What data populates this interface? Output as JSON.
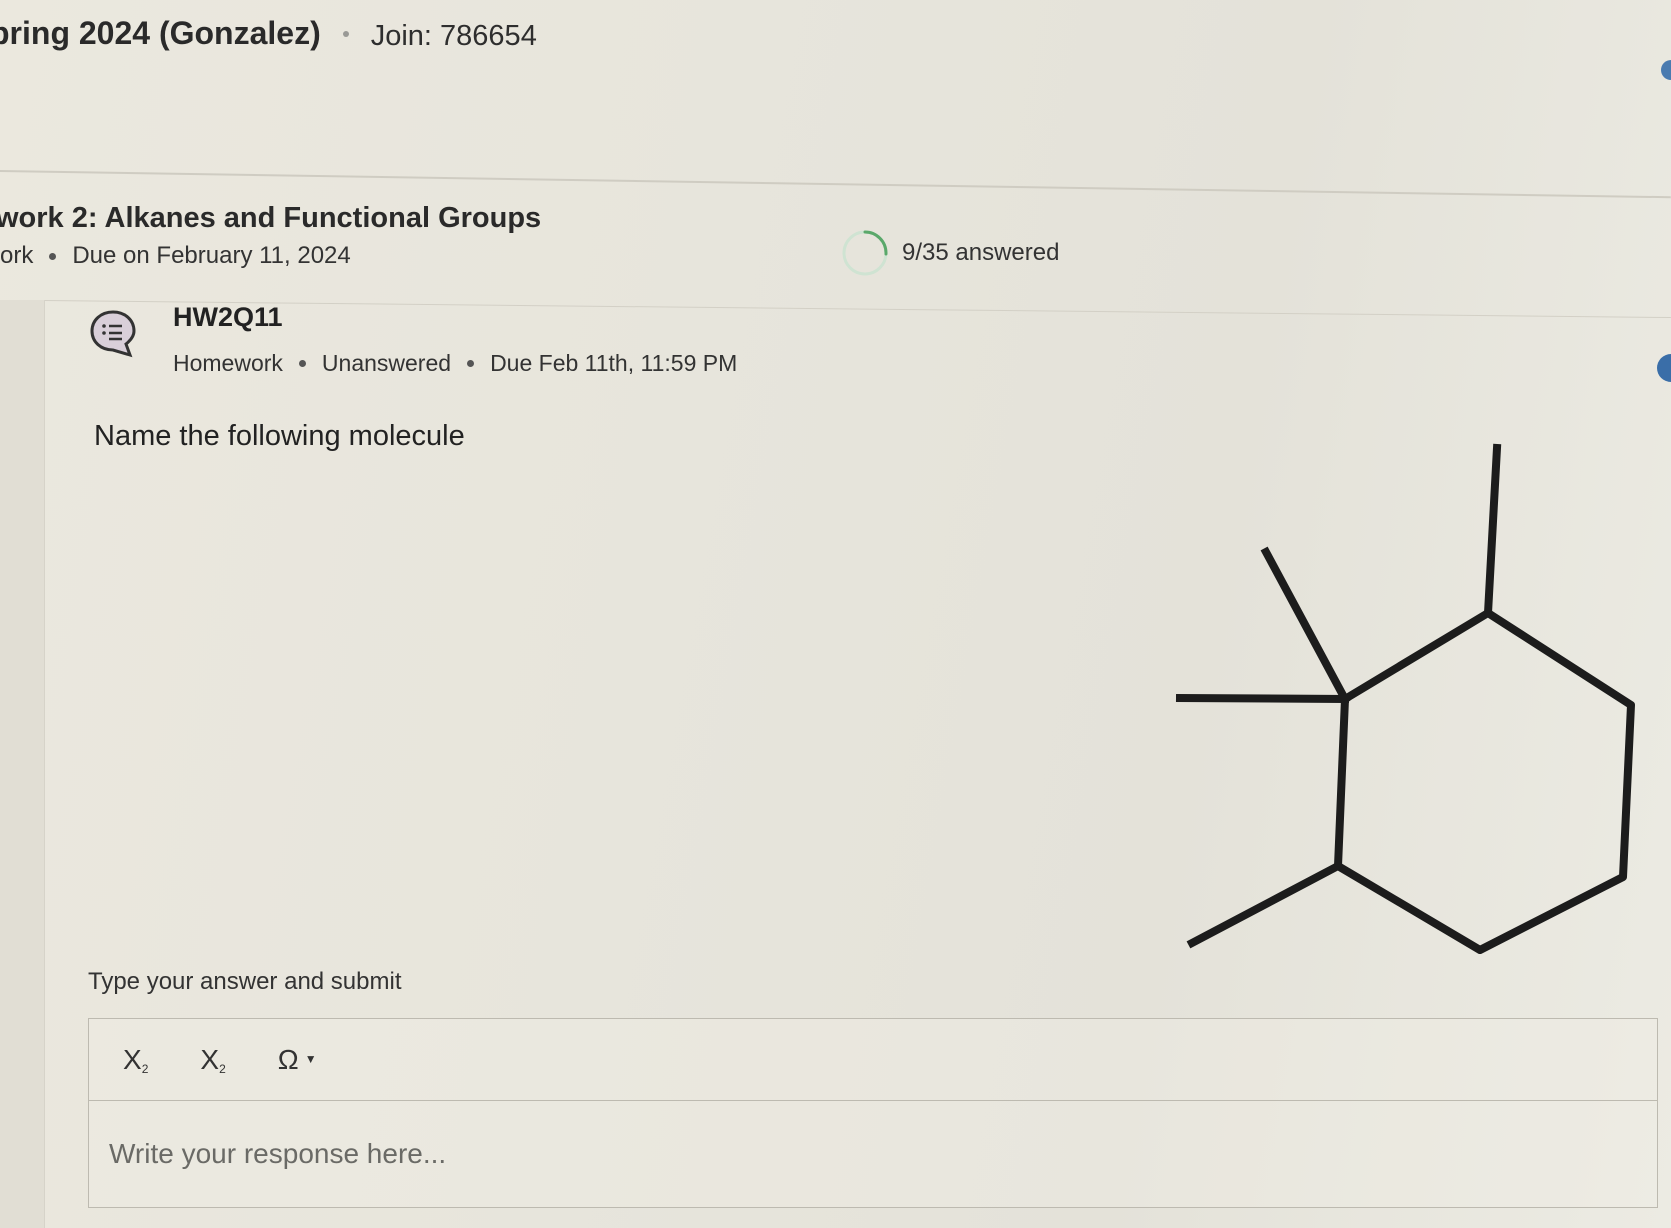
{
  "header": {
    "course_title": "pring 2024 (Gonzalez)",
    "join_code": "Join: 786654"
  },
  "assignment": {
    "title": "work 2: Alkanes and Functional Groups",
    "type_fragment": "ork",
    "due": "Due on February 11, 2024",
    "progress": {
      "answered": 9,
      "total": 35,
      "text": "9/35 answered"
    }
  },
  "question": {
    "id": "HW2Q11",
    "icon": "question-list-icon",
    "type": "Homework",
    "status": "Unanswered",
    "due": "Due Feb 11th, 11:59 PM",
    "prompt": "Name the following molecule"
  },
  "answer": {
    "label": "Type your answer and submit",
    "toolbar": {
      "subscript_label": "X",
      "subscript_mark": "2",
      "superscript_label": "X",
      "superscript_mark": "2",
      "special_chars_label": "Ω",
      "caret_icon": "caret-down-icon"
    },
    "placeholder": "Write your response here...",
    "value": ""
  },
  "colors": {
    "background": "#e9e6dc",
    "text": "#222222",
    "icon_bg": "#d9cfd9",
    "icon_stroke": "#333333",
    "progress_ring": "#5aa86a",
    "accent_blue": "#3a6ea8"
  }
}
